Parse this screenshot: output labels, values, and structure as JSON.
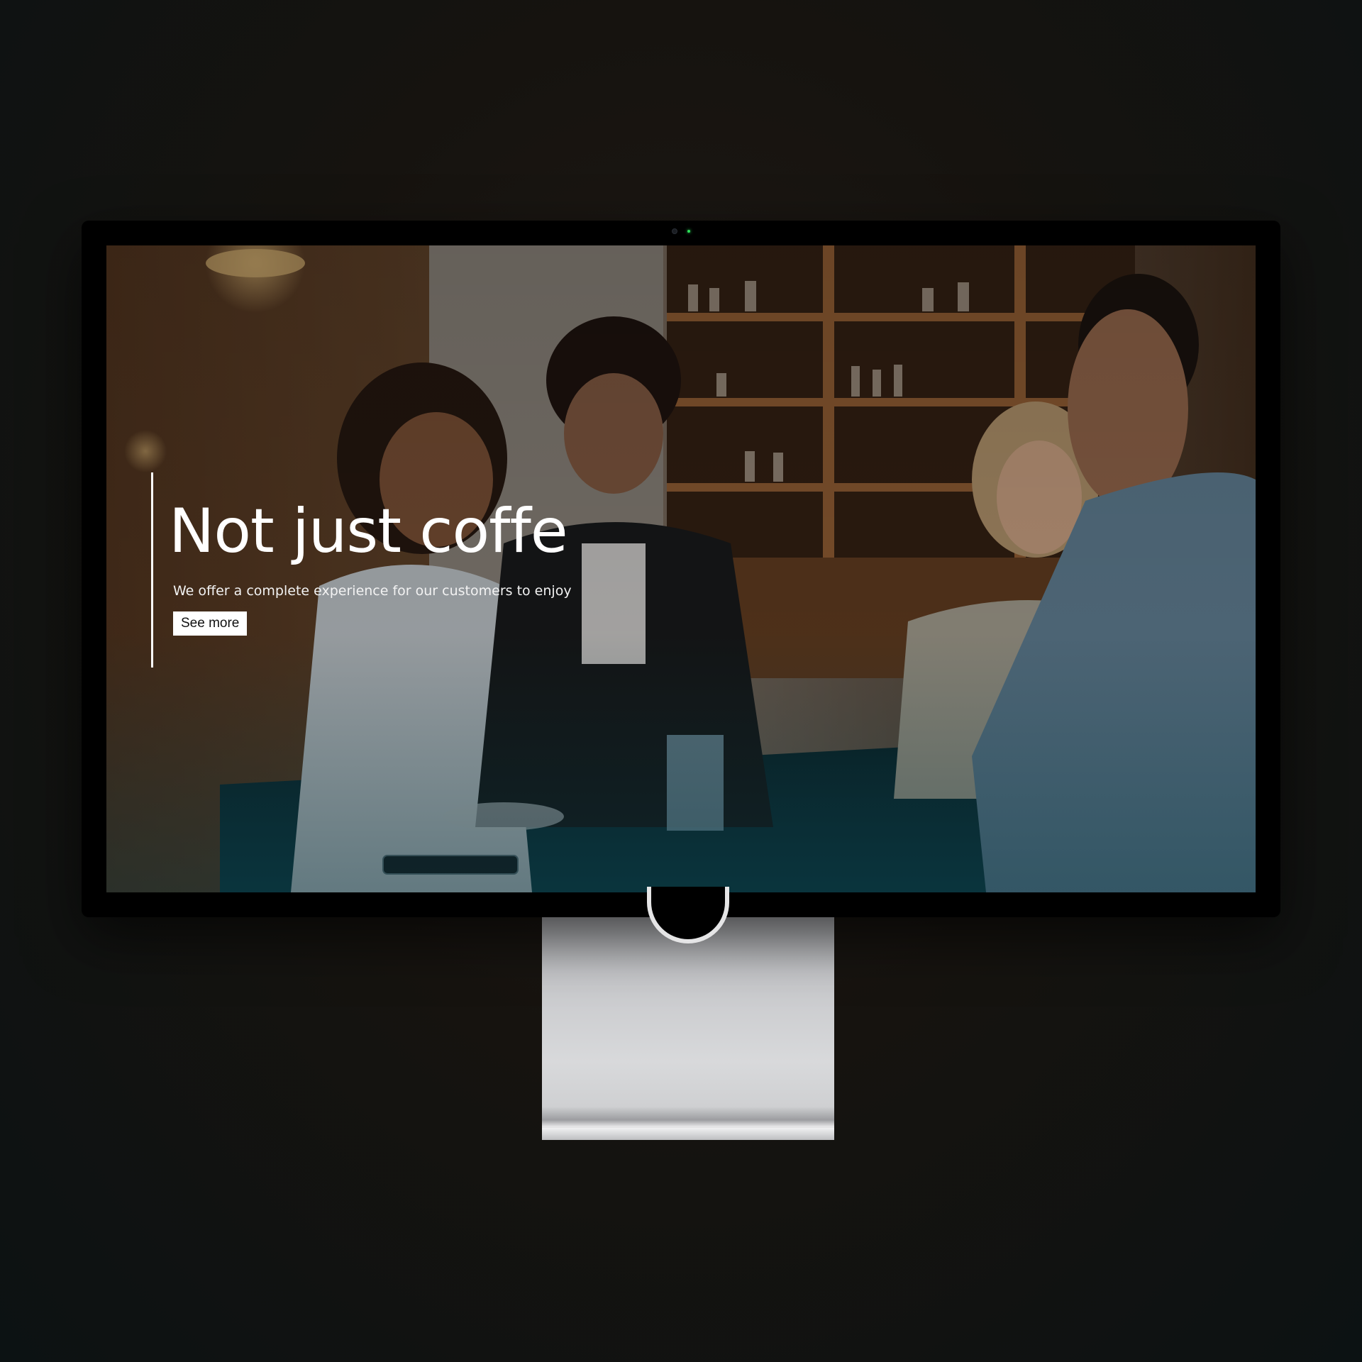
{
  "hero": {
    "title": "Not just coffe",
    "subtitle": "We offer a complete experience for our customers to enjoy",
    "button_label": "See more"
  },
  "colors": {
    "accent_line": "#ffffff",
    "button_bg": "#ffffff",
    "button_text": "#111111",
    "camera_led": "#2ee05a"
  },
  "icons": [
    "camera-icon",
    "camera-indicator-led"
  ]
}
